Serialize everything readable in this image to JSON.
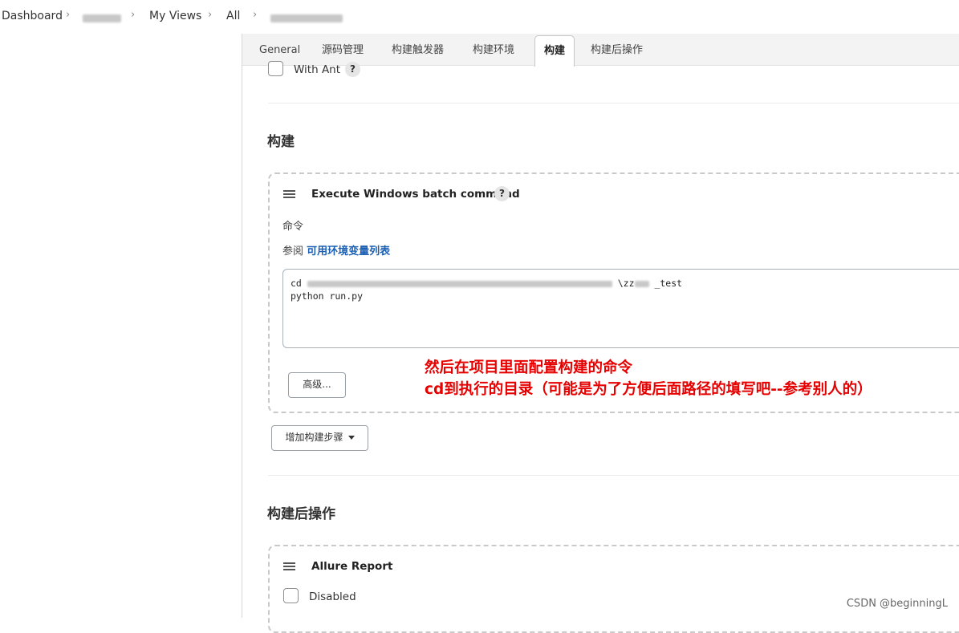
{
  "breadcrumb": {
    "dashboard": "Dashboard",
    "my_views": "My Views",
    "all": "All"
  },
  "tabs": [
    {
      "label": "General"
    },
    {
      "label": "源码管理"
    },
    {
      "label": "构建触发器"
    },
    {
      "label": "构建环境"
    },
    {
      "label": "构建",
      "active": true
    },
    {
      "label": "构建后操作"
    }
  ],
  "with_ant": {
    "label": "With Ant",
    "checked": false,
    "help": "?"
  },
  "build_section": {
    "title": "构建",
    "step": {
      "title": "Execute Windows batch command",
      "help": "?",
      "command_label": "命令",
      "see_prefix": "参阅",
      "env_link": "可用环境变量列表",
      "command_line1_prefix": "cd",
      "command_line1_suffix": "\\zz",
      "command_line1_tail": "_test",
      "command_line2": "python run.py",
      "advanced_button": "高级..."
    },
    "add_step_button": "增加构建步骤"
  },
  "annotation": {
    "line1": "然后在项目里面配置构建的命令",
    "line2": "cd到执行的目录（可能是为了方便后面路径的填写吧--参考别人的）",
    "color": "#e60000"
  },
  "post_build_section": {
    "title": "构建后操作",
    "step": {
      "title": "Allure Report",
      "disabled_label": "Disabled",
      "disabled_checked": false
    }
  },
  "watermark": "CSDN @beginningL"
}
